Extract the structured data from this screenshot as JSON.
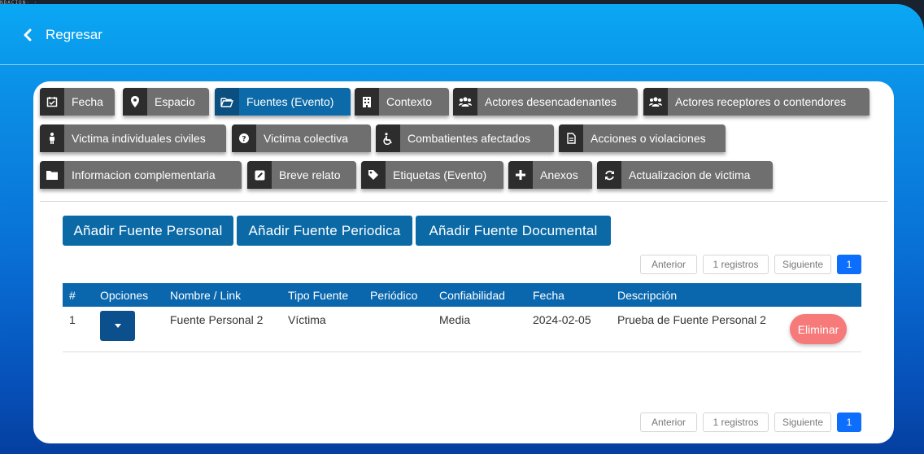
{
  "corner_text": "NDACION· ·",
  "header": {
    "back_label": "Regresar"
  },
  "tabs": [
    {
      "label": "Fecha",
      "icon": "calendar-check-icon"
    },
    {
      "label": "Espacio",
      "icon": "map-marker-icon"
    },
    {
      "label": "Fuentes (Evento)",
      "icon": "folder-open-icon",
      "active": true
    },
    {
      "label": "Contexto",
      "icon": "building-icon"
    },
    {
      "label": "Actores desencadenantes",
      "icon": "users-icon"
    },
    {
      "label": "Actores receptores o contendores",
      "icon": "users-icon"
    },
    {
      "label": "Victima individuales civiles",
      "icon": "person-icon"
    },
    {
      "label": "Victima colectiva",
      "icon": "question-circle-icon"
    },
    {
      "label": "Combatientes afectados",
      "icon": "wheelchair-icon"
    },
    {
      "label": "Acciones o violaciones",
      "icon": "file-text-icon"
    },
    {
      "label": "Informacion complementaria",
      "icon": "folder-icon"
    },
    {
      "label": "Breve relato",
      "icon": "edit-icon"
    },
    {
      "label": "Etiquetas (Evento)",
      "icon": "tag-icon"
    },
    {
      "label": "Anexos",
      "icon": "plus-icon"
    },
    {
      "label": "Actualizacion de victima",
      "icon": "refresh-icon"
    }
  ],
  "actions": {
    "add_personal": "Añadir Fuente Personal",
    "add_periodica": "Añadir Fuente Periodica",
    "add_documental": "Añadir Fuente Documental"
  },
  "pager": {
    "prev": "Anterior",
    "info": "1 registros",
    "next": "Siguiente",
    "page": "1"
  },
  "table": {
    "columns": [
      "#",
      "Opciones",
      "Nombre / Link",
      "Tipo Fuente",
      "Periódico",
      "Confiabilidad",
      "Fecha",
      "Descripción"
    ],
    "rows": [
      {
        "num": "1",
        "nombre": "Fuente Personal 2",
        "tipo": "Víctima",
        "periodico": "",
        "confiabilidad": "Media",
        "fecha": "2024-02-05",
        "descripcion": "Prueba de Fuente Personal 2",
        "delete_label": "Eliminar"
      }
    ]
  },
  "colors": {
    "accent": "#0b6aa6",
    "active_tab": "#0c6aa8",
    "tab": "#6f6f6f",
    "delete": "#f77a7a",
    "page_active": "#0d6efd"
  }
}
